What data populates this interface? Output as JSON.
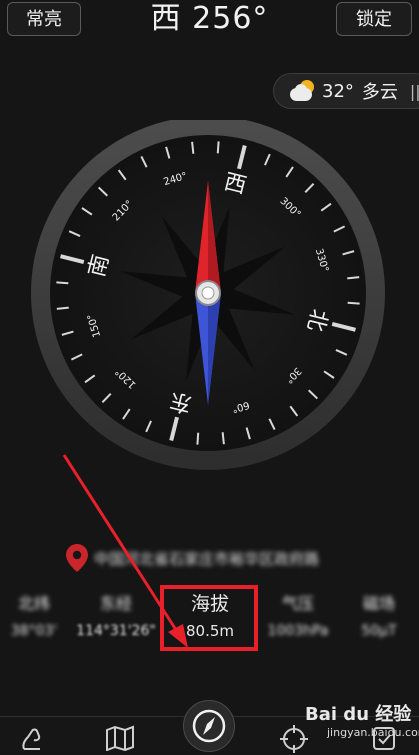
{
  "header": {
    "left_button": "常亮",
    "heading_direction": "西",
    "heading_degrees": "256°",
    "right_button": "锁定"
  },
  "weather": {
    "temperature": "32°",
    "condition": "多云",
    "more": "||-"
  },
  "compass": {
    "heading_degrees": 256,
    "cardinals": [
      {
        "label": "北",
        "deg": 0
      },
      {
        "label": "东",
        "deg": 90
      },
      {
        "label": "南",
        "deg": 180
      },
      {
        "label": "西",
        "deg": 270
      }
    ],
    "degree_labels": [
      {
        "label": "30°",
        "deg": 30
      },
      {
        "label": "60°",
        "deg": 60
      },
      {
        "label": "120°",
        "deg": 120
      },
      {
        "label": "150°",
        "deg": 150
      },
      {
        "label": "210°",
        "deg": 210
      },
      {
        "label": "240°",
        "deg": 240
      },
      {
        "label": "300°",
        "deg": 300
      },
      {
        "label": "330°",
        "deg": 330
      }
    ],
    "colors": {
      "needle_north": "#e0242b",
      "needle_south": "#3d55d6",
      "ring": "#444444"
    }
  },
  "location": {
    "address": "中国河北省石家庄市裕华区政府路"
  },
  "stats": [
    {
      "label": "北纬",
      "value": "38°03'"
    },
    {
      "label": "东经",
      "value": "114°31'26\""
    },
    {
      "label": "海拔",
      "value": "80.5m"
    },
    {
      "label": "气压",
      "value": "1003hPa"
    },
    {
      "label": "磁场",
      "value": "50μT"
    }
  ],
  "watermark": {
    "brand": "Bai du 经验",
    "url": "jingyan.baidu.com"
  },
  "colors": {
    "highlight": "#e8202a",
    "background": "#151515"
  }
}
